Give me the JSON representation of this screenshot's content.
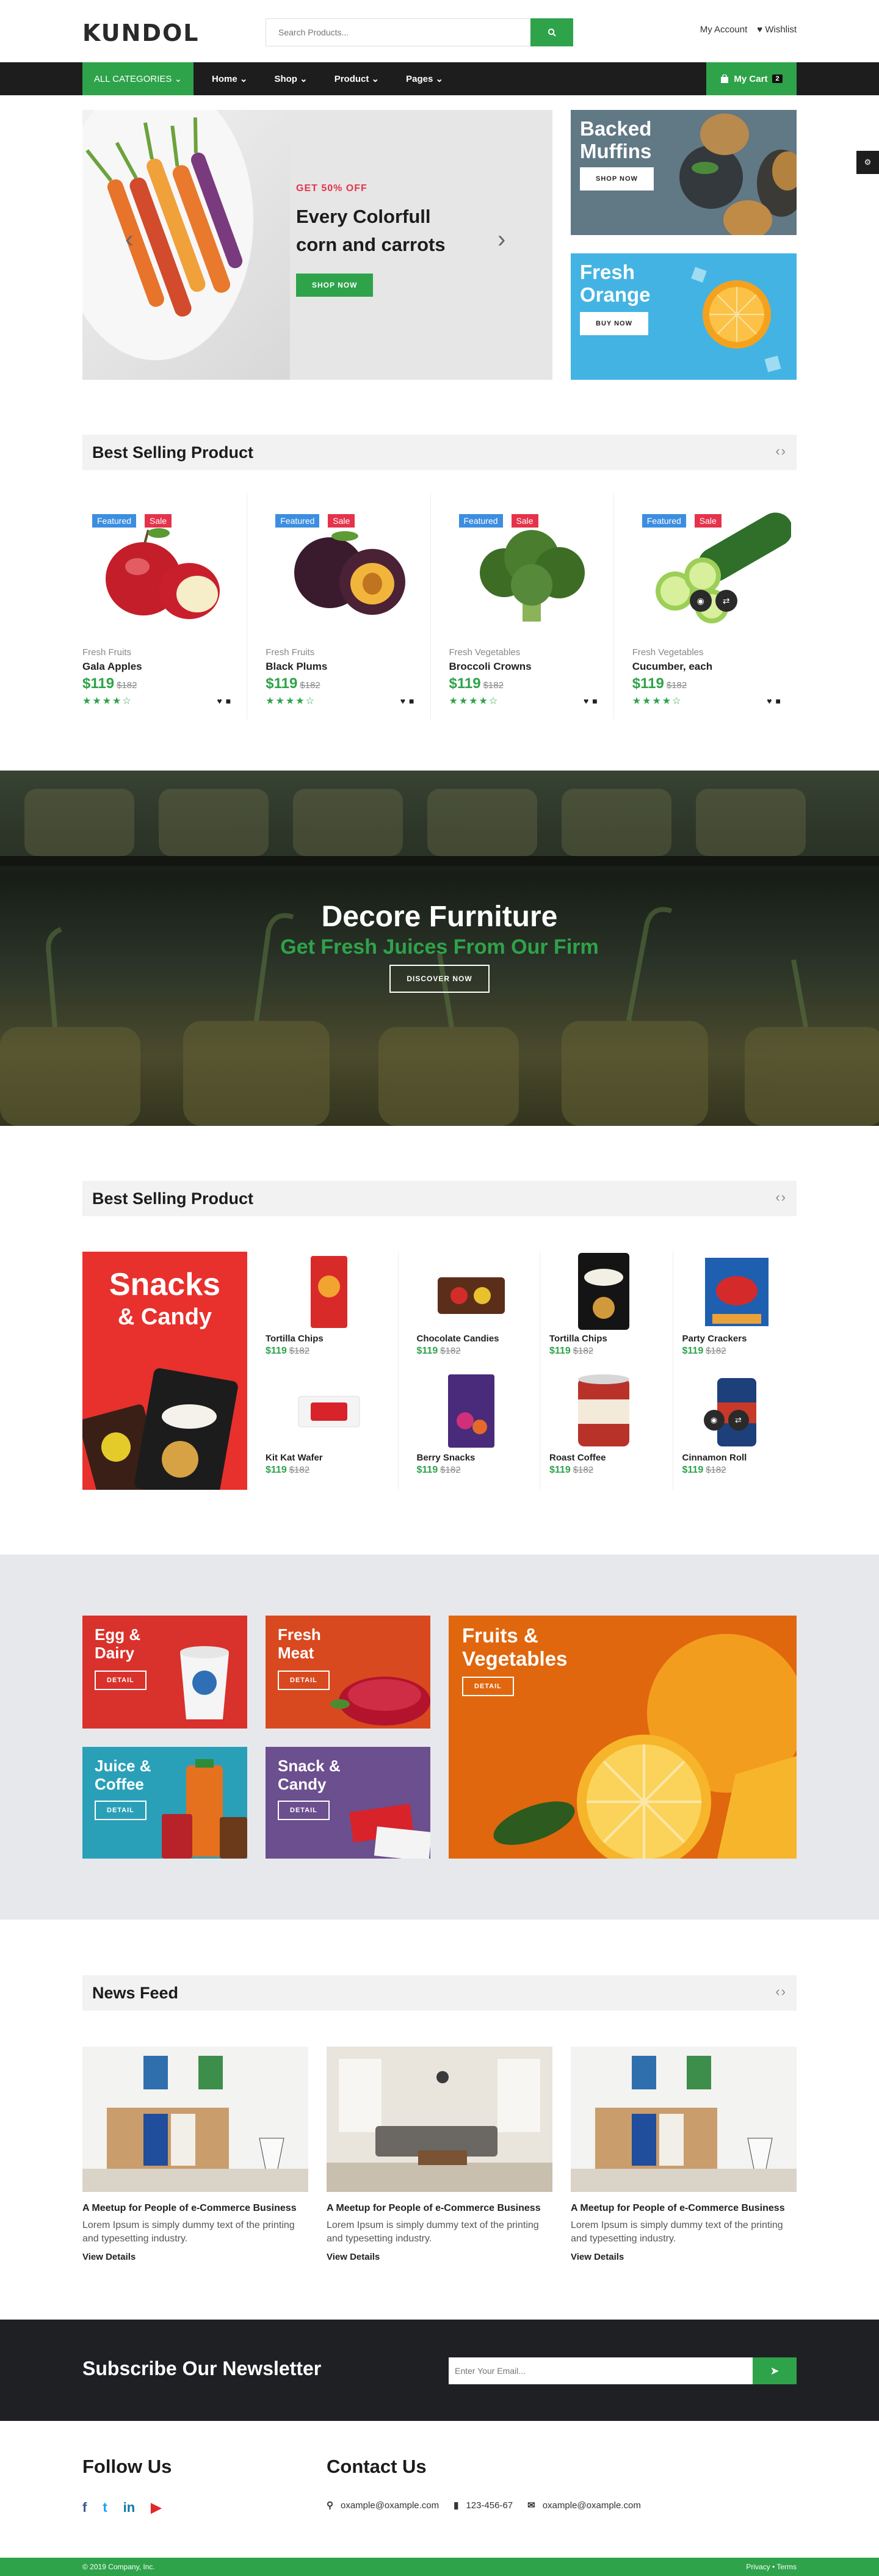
{
  "header": {
    "logo": "KUNDOL",
    "search_placeholder": "Search Products...",
    "my_account": "My Account",
    "wishlist": "Wishlist"
  },
  "nav": {
    "all_categories": "ALL CATEGORIES",
    "items": [
      "Home",
      "Shop",
      "Product",
      "Pages"
    ],
    "cart_label": "My Cart",
    "cart_count": "2"
  },
  "hero": {
    "offer": "GET 50% OFF",
    "title_line1": "Every Colorfull",
    "title_line2": "corn and carrots",
    "button": "SHOP NOW"
  },
  "side_banners": [
    {
      "title_line1": "Backed",
      "title_line2": "Muffins",
      "button": "SHOP NOW"
    },
    {
      "title_line1": "Fresh",
      "title_line2": "Orange",
      "button": "BUY NOW"
    }
  ],
  "best_selling_1": {
    "title": "Best Selling Product",
    "badges": {
      "featured": "Featured",
      "sale": "Sale"
    },
    "products": [
      {
        "category": "Fresh Fruits",
        "name": "Gala Apples",
        "price": "$119",
        "old_price": "$182"
      },
      {
        "category": "Fresh Fruits",
        "name": "Black Plums",
        "price": "$119",
        "old_price": "$182"
      },
      {
        "category": "Fresh Vegetables",
        "name": "Broccoli Crowns",
        "price": "$119",
        "old_price": "$182"
      },
      {
        "category": "Fresh Vegetables",
        "name": "Cucumber, each",
        "price": "$119",
        "old_price": "$182"
      }
    ]
  },
  "parallax": {
    "title": "Decore Furniture",
    "subtitle": "Get Fresh Juices From Our Firm",
    "button": "DISCOVER NOW"
  },
  "best_selling_2": {
    "title": "Best Selling Product",
    "promo_line1": "Snacks",
    "promo_line2": "& Candy",
    "items": [
      {
        "name": "Tortilla Chips",
        "price": "$119",
        "old_price": "$182"
      },
      {
        "name": "Chocolate Candies",
        "price": "$119",
        "old_price": "$182"
      },
      {
        "name": "Tortilla Chips",
        "price": "$119",
        "old_price": "$182"
      },
      {
        "name": "Party Crackers",
        "price": "$119",
        "old_price": "$182"
      },
      {
        "name": "Kit Kat Wafer",
        "price": "$119",
        "old_price": "$182"
      },
      {
        "name": "Berry Snacks",
        "price": "$119",
        "old_price": "$182"
      },
      {
        "name": "Roast Coffee",
        "price": "$119",
        "old_price": "$182"
      },
      {
        "name": "Cinnamon Roll",
        "price": "$119",
        "old_price": "$182"
      }
    ]
  },
  "categories": [
    {
      "line1": "Egg &",
      "line2": "Dairy",
      "button": "DETAIL",
      "color": "#d9312b"
    },
    {
      "line1": "Fresh",
      "line2": "Meat",
      "button": "DETAIL",
      "color": "#d8491f"
    },
    {
      "line1": "Juice &",
      "line2": "Coffee",
      "button": "DETAIL",
      "color": "#2aa0b8"
    },
    {
      "line1": "Snack &",
      "line2": "Candy",
      "button": "DETAIL",
      "color": "#6b4f8e"
    },
    {
      "line1": "Fruits &",
      "line2": "Vegetables",
      "button": "DETAIL",
      "color": "#e0670e"
    }
  ],
  "news": {
    "title": "News Feed",
    "posts": [
      {
        "title": "A Meetup for People of e-Commerce Business",
        "excerpt": "Lorem Ipsum is simply dummy text of the printing and typesetting industry.",
        "link": "View Details"
      },
      {
        "title": "A Meetup for People of e-Commerce Business",
        "excerpt": "Lorem Ipsum is simply dummy text of the printing and typesetting industry.",
        "link": "View Details"
      },
      {
        "title": "A Meetup for People of e-Commerce Business",
        "excerpt": "Lorem Ipsum is simply dummy text of the printing and typesetting industry.",
        "link": "View Details"
      }
    ]
  },
  "newsletter": {
    "title": "Subscribe Our Newsletter",
    "placeholder": "Enter Your Email..."
  },
  "footer": {
    "follow_title": "Follow Us",
    "contact_title": "Contact Us",
    "email1": "oxample@oxample.com",
    "phone": "123-456-67",
    "email2": "oxample@oxample.com",
    "copyright": "© 2019 Company, Inc.",
    "links": "Privacy • Terms"
  },
  "colors": {
    "accent": "#2ea34a",
    "sale": "#e5334b",
    "featured": "#3c8ee0",
    "dark": "#1d1d1d"
  }
}
